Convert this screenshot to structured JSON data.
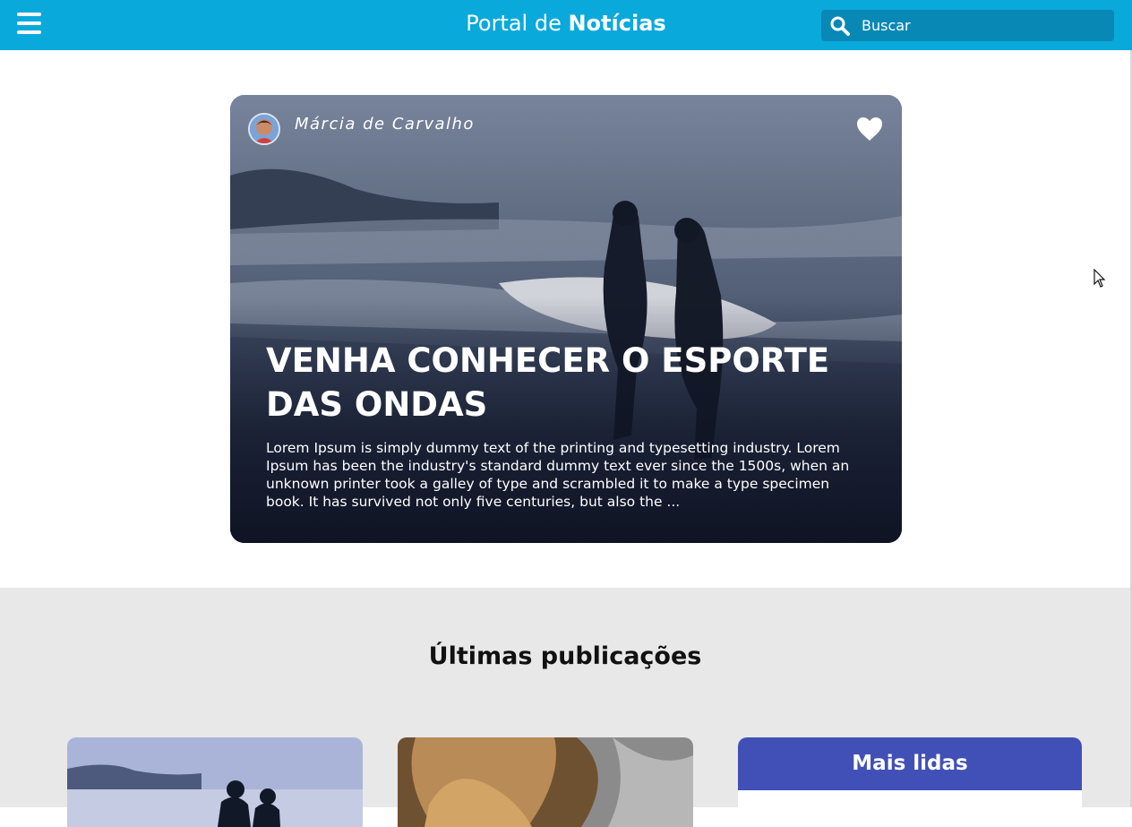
{
  "header": {
    "brand_prefix": "Portal de",
    "brand_bold": "Notícias",
    "search_placeholder": "Buscar",
    "menu_icon": "hamburger-menu-icon",
    "search_icon": "search-icon"
  },
  "colors": {
    "header": "#0aa9db",
    "search": "#0888b5",
    "section_bg": "#e8e8e8",
    "most_read_header": "#4150b6"
  },
  "featured": {
    "author": "Márcia de Carvalho",
    "title": "VENHA CONHECER O ESPORTE DAS ONDAS",
    "excerpt": "Lorem Ipsum is simply dummy text of the printing and typesetting industry. Lorem Ipsum has been the industry's standard dummy text ever since the 1500s, when an unknown printer took a galley of type and scrambled it to make a type specimen book. It has survived not only five centuries, but also the ...",
    "favorite_icon": "heart-icon"
  },
  "latest": {
    "title": "Últimas publicações"
  },
  "most_read": {
    "title": "Mais lidas"
  }
}
